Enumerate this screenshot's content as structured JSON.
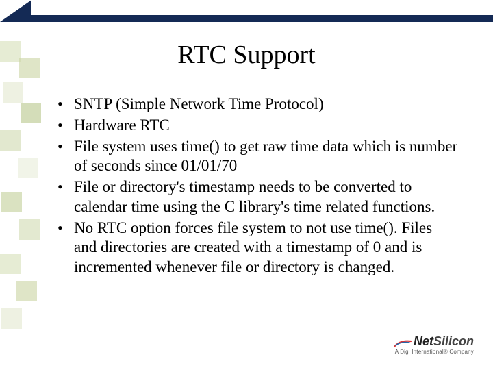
{
  "title": "RTC Support",
  "bullets": [
    "SNTP (Simple Network Time Protocol)",
    "Hardware RTC",
    "File system uses time() to get raw time data which is number of seconds since 01/01/70",
    "File or directory's timestamp needs to be converted to calendar time using the C library's time related functions.",
    "No RTC option forces file system to not use time(). Files and directories are created with a timestamp of 0 and is incremented whenever file or directory is changed."
  ],
  "logo": {
    "brand_left": "Net",
    "brand_right": "Silicon",
    "tagline": "A Digi International® Company"
  },
  "mosaic_colors": [
    "#d6dfb8",
    "#c9d4a2",
    "#e3e8cf",
    "#b8c78b",
    "#cfd9af",
    "#e8ecd9",
    "#c2ce97",
    "#d0dab1"
  ]
}
